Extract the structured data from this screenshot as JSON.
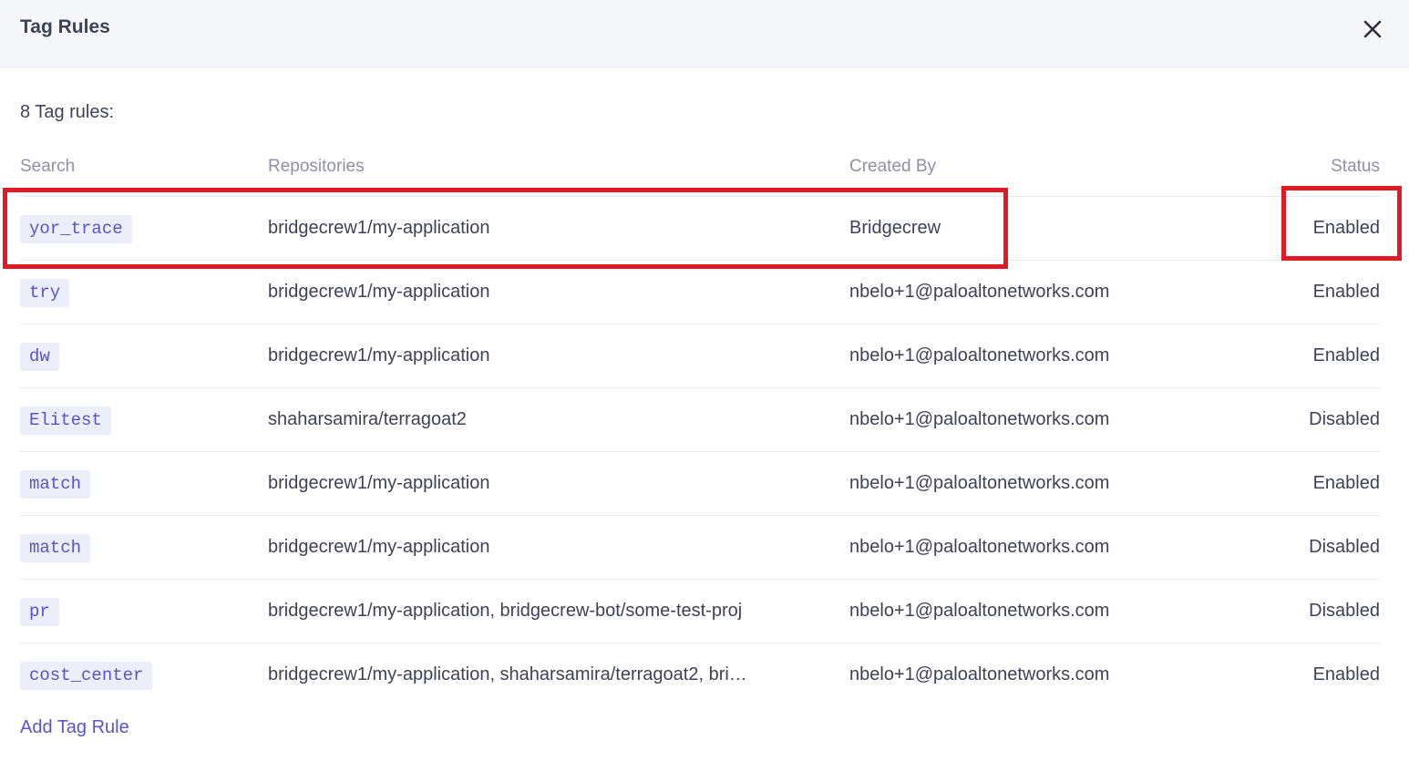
{
  "dialog": {
    "title": "Tag Rules",
    "count_label": "8 Tag rules:",
    "add_label": "Add Tag Rule",
    "close_icon": "close-icon"
  },
  "table": {
    "headers": {
      "search": "Search",
      "repositories": "Repositories",
      "created_by": "Created By",
      "status": "Status"
    },
    "rows": [
      {
        "search": "yor_trace",
        "repositories": "bridgecrew1/my-application",
        "created_by": "Bridgecrew",
        "status": "Enabled"
      },
      {
        "search": "try",
        "repositories": "bridgecrew1/my-application",
        "created_by": "nbelo+1@paloaltonetworks.com",
        "status": "Enabled"
      },
      {
        "search": "dw",
        "repositories": "bridgecrew1/my-application",
        "created_by": "nbelo+1@paloaltonetworks.com",
        "status": "Enabled"
      },
      {
        "search": "Elitest",
        "repositories": "shaharsamira/terragoat2",
        "created_by": "nbelo+1@paloaltonetworks.com",
        "status": "Disabled"
      },
      {
        "search": "match",
        "repositories": "bridgecrew1/my-application",
        "created_by": "nbelo+1@paloaltonetworks.com",
        "status": "Enabled"
      },
      {
        "search": "match",
        "repositories": "bridgecrew1/my-application",
        "created_by": "nbelo+1@paloaltonetworks.com",
        "status": "Disabled"
      },
      {
        "search": "pr",
        "repositories": "bridgecrew1/my-application, bridgecrew-bot/some-test-proj",
        "created_by": "nbelo+1@paloaltonetworks.com",
        "status": "Disabled"
      },
      {
        "search": "cost_center",
        "repositories": "bridgecrew1/my-application, shaharsamira/terragoat2, bri…",
        "created_by": "nbelo+1@paloaltonetworks.com",
        "status": "Enabled"
      }
    ]
  },
  "colors": {
    "highlight": "#e01b24",
    "accent": "#5b54c4",
    "tag_bg": "#eceefa"
  }
}
